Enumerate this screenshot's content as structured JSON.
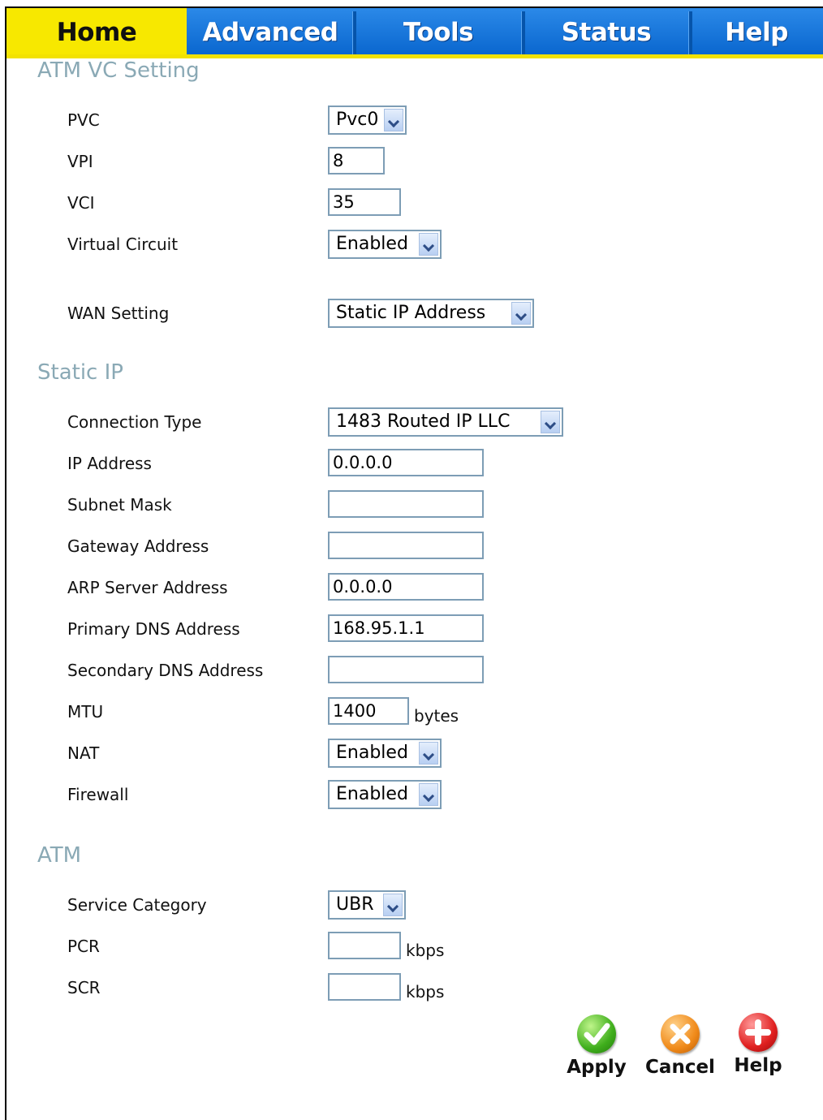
{
  "nav": {
    "tabs": [
      {
        "label": "Home"
      },
      {
        "label": "Advanced"
      },
      {
        "label": "Tools"
      },
      {
        "label": "Status"
      },
      {
        "label": "Help"
      }
    ]
  },
  "atm_vc": {
    "title": "ATM VC Setting",
    "pvc_label": "PVC",
    "pvc_value": "Pvc0",
    "vpi_label": "VPI",
    "vpi_value": "8",
    "vci_label": "VCI",
    "vci_value": "35",
    "virtual_circuit_label": "Virtual Circuit",
    "virtual_circuit_value": "Enabled",
    "wan_setting_label": "WAN Setting",
    "wan_setting_value": "Static IP Address"
  },
  "static_ip": {
    "title": "Static IP",
    "connection_type_label": "Connection Type",
    "connection_type_value": "1483 Routed IP LLC",
    "ip_address_label": "IP Address",
    "ip_address_value": "0.0.0.0",
    "subnet_mask_label": "Subnet Mask",
    "subnet_mask_value": "",
    "gateway_label": "Gateway Address",
    "gateway_value": "",
    "arp_label": "ARP Server Address",
    "arp_value": "0.0.0.0",
    "primary_dns_label": "Primary DNS Address",
    "primary_dns_value": "168.95.1.1",
    "secondary_dns_label": "Secondary DNS Address",
    "secondary_dns_value": "",
    "mtu_label": "MTU",
    "mtu_value": "1400",
    "mtu_unit": "bytes",
    "nat_label": "NAT",
    "nat_value": "Enabled",
    "firewall_label": "Firewall",
    "firewall_value": "Enabled"
  },
  "atm": {
    "title": "ATM",
    "service_category_label": "Service Category",
    "service_category_value": "UBR",
    "pcr_label": "PCR",
    "pcr_value": "",
    "pcr_unit": "kbps",
    "scr_label": "SCR",
    "scr_value": "",
    "scr_unit": "kbps"
  },
  "actions": {
    "apply_label": "Apply",
    "cancel_label": "Cancel",
    "help_label": "Help"
  }
}
